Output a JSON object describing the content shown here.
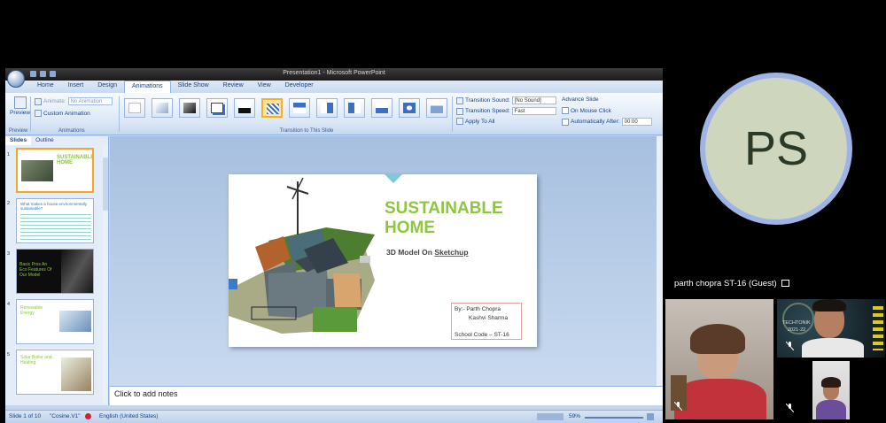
{
  "ppt": {
    "title": "Presentation1 - Microsoft PowerPoint",
    "tabs": [
      "Home",
      "Insert",
      "Design",
      "Animations",
      "Slide Show",
      "Review",
      "View",
      "Developer"
    ],
    "active_tab": "Animations",
    "preview_group": {
      "button": "Preview",
      "label": "Preview"
    },
    "animations_group": {
      "animate_label": "Animate:",
      "animate_value": "No Animation",
      "custom": "Custom Animation",
      "label": "Animations"
    },
    "transitions_label": "Transition to This Slide",
    "sound": {
      "label": "Transition Sound:",
      "value": "[No Sound]"
    },
    "speed": {
      "label": "Transition Speed:",
      "value": "Fast"
    },
    "apply_all": "Apply To All",
    "advance": {
      "title": "Advance Slide",
      "on_click": "On Mouse Click",
      "after": "Automatically After:",
      "after_value": "00:00"
    },
    "pane_tabs": [
      "Slides",
      "Outline"
    ],
    "thumbnails": [
      {
        "num": "1",
        "title": "SUSTAINABLE HOME"
      },
      {
        "num": "2",
        "title": "What makes a house environmentally sustainable?"
      },
      {
        "num": "3",
        "title": "Basic Pros An Eco Features Of Our Model"
      },
      {
        "num": "4",
        "title": "Renewable Energy"
      },
      {
        "num": "5",
        "title": "Solar Boiler and Heating"
      }
    ],
    "slide": {
      "title_line1": "SUSTAINABLE",
      "title_line2": "HOME",
      "subtitle_prefix": "3D Model On ",
      "subtitle_link": "Sketchup",
      "by": "By:- Parth Chopra",
      "by2": "Kashvi Sharma",
      "school": "School Code – ST-16"
    },
    "notes": "Click to add notes",
    "status": {
      "slide": "Slide 1 of 10",
      "theme": "\"Cosine.V1\"",
      "lang": "English (United States)",
      "zoom": "59%"
    }
  },
  "meeting": {
    "avatar_initials": "PS",
    "participant_name": "parth chopra ST-16 (Guest)",
    "tile_badge": "TECHTONIK",
    "tile_year": "2021-22"
  },
  "colors": {
    "accent_green": "#8dc63f",
    "ribbon_blue": "#15428b",
    "avatar_bg": "#cfd6be",
    "avatar_ring": "#9fb4e6"
  }
}
